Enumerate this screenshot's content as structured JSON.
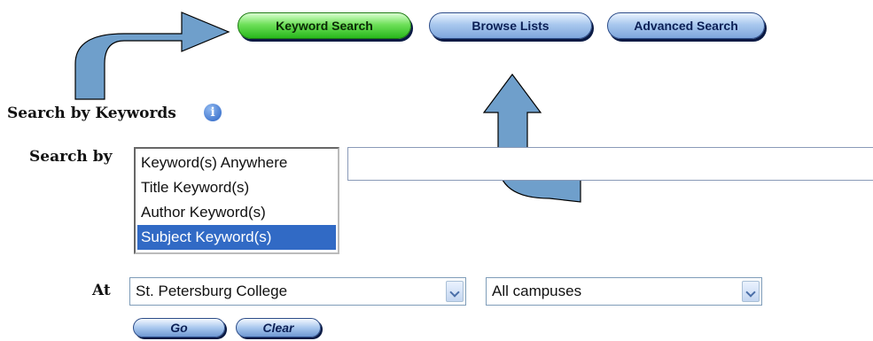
{
  "tabs": [
    {
      "label": "Keyword Search",
      "active": true
    },
    {
      "label": "Browse Lists",
      "active": false
    },
    {
      "label": "Advanced Search",
      "active": false
    }
  ],
  "section_heading": "Search by Keywords",
  "search_by_label": "Search by",
  "search_by_options": [
    "Keyword(s) Anywhere",
    "Title Keyword(s)",
    "Author Keyword(s)",
    "Subject Keyword(s)"
  ],
  "search_by_selected": "Subject Keyword(s)",
  "search_input_value": "",
  "at_label": "At",
  "library_select": "St. Petersburg College",
  "campus_select": "All campuses",
  "go_label": "Go",
  "clear_label": "Clear",
  "colors": {
    "arrow_fill": "#6f9fcb",
    "active_tab": "#3fcf2e",
    "selection": "#316ac5"
  }
}
